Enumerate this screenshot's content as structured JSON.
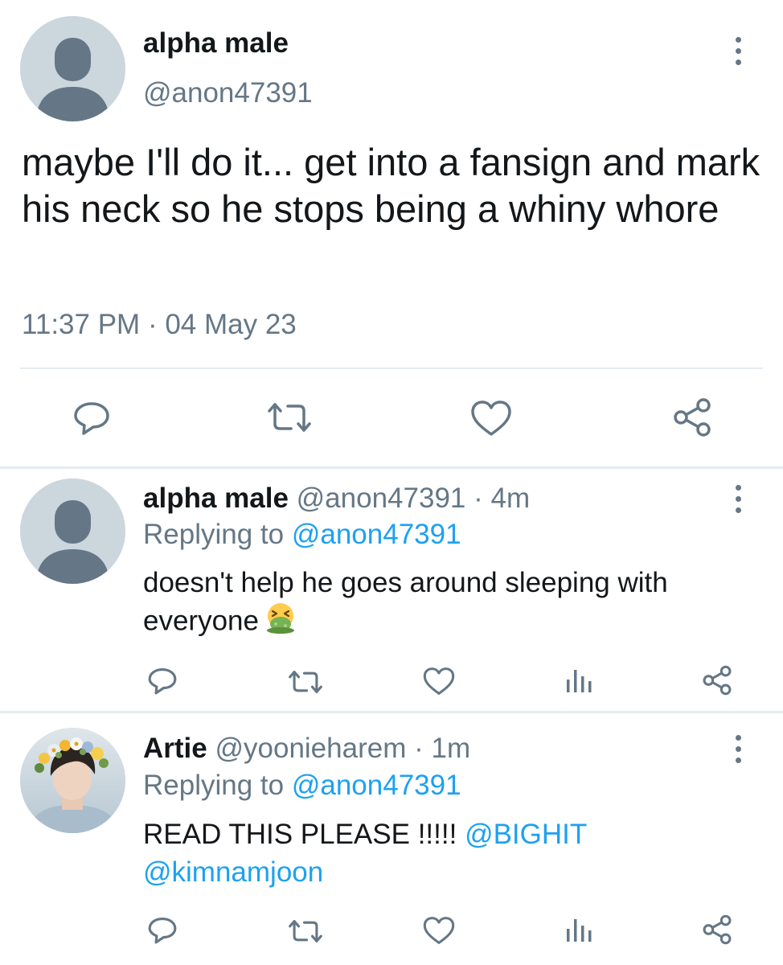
{
  "main_tweet": {
    "display_name": "alpha male",
    "handle": "@anon47391",
    "text": "maybe I'll do it... get into a fansign and mark his neck so he stops being a whiny whore",
    "time": "11:37 PM",
    "separator": "·",
    "date": "04 May 23",
    "actions": [
      "reply-icon",
      "retweet-icon",
      "like-icon",
      "share-icon"
    ]
  },
  "replies": [
    {
      "display_name": "alpha male",
      "handle": "@anon47391",
      "dot": "·",
      "age": "4m",
      "replying_label": "Replying to",
      "replying_to": "@anon47391",
      "text": "doesn't help he goes around sleeping with everyone",
      "emoji": "nauseated-face-icon",
      "actions": [
        "reply-icon",
        "retweet-icon",
        "like-icon",
        "analytics-icon",
        "share-icon"
      ]
    },
    {
      "display_name": "Artie",
      "handle": "@yoonieharem",
      "dot": "·",
      "age": "1m",
      "replying_label": "Replying to",
      "replying_to": "@anon47391",
      "text": "READ THIS PLEASE !!!!!",
      "mention_1": "@BIGHIT",
      "mention_2": "@kimnamjoon",
      "actions": [
        "reply-icon",
        "retweet-icon",
        "like-icon",
        "analytics-icon",
        "share-icon"
      ]
    }
  ],
  "colors": {
    "text": "#14171a",
    "secondary": "#657786",
    "link": "#1da1f2",
    "divider": "#e6ecf0",
    "avatar_bg": "#ccd6dd",
    "avatar_fg": "#657786"
  }
}
